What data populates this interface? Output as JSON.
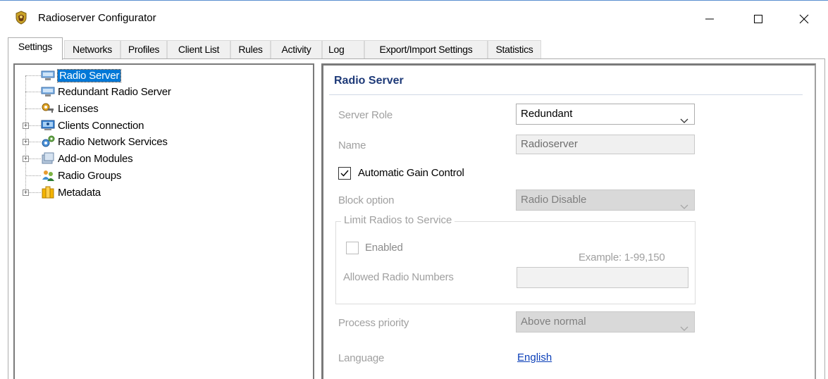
{
  "window": {
    "title": "Radioserver Configurator",
    "controls": {
      "minimize": "minimize-icon",
      "maximize": "maximize-icon",
      "close": "close-icon"
    }
  },
  "tabs": [
    "Settings",
    "Networks",
    "Profiles",
    "Client List",
    "Rules",
    "Activity",
    "Log",
    "Export/Import Settings",
    "Statistics"
  ],
  "active_tab": "Settings",
  "tree": {
    "items": [
      {
        "label": "Radio Server",
        "icon": "server-icon",
        "selected": true
      },
      {
        "label": "Redundant Radio Server",
        "icon": "server-icon"
      },
      {
        "label": "Licenses",
        "icon": "key-icon"
      },
      {
        "label": "Clients Connection",
        "icon": "network-icon",
        "expandable": true
      },
      {
        "label": "Radio Network Services",
        "icon": "gear-network-icon",
        "expandable": true
      },
      {
        "label": "Add-on Modules",
        "icon": "modules-icon",
        "expandable": true
      },
      {
        "label": "Radio Groups",
        "icon": "users-icon"
      },
      {
        "label": "Metadata",
        "icon": "metadata-icon",
        "expandable": true
      }
    ]
  },
  "settings": {
    "section_title": "Radio Server",
    "server_role": {
      "label": "Server Role",
      "value": "Redundant"
    },
    "name": {
      "label": "Name",
      "value": "Radioserver"
    },
    "agc": {
      "label": "Automatic Gain Control",
      "checked": true
    },
    "block_option": {
      "label": "Block option",
      "value": "Radio Disable"
    },
    "limit_group": {
      "legend": "Limit Radios to Service",
      "enabled_label": "Enabled",
      "enabled": false,
      "example": "Example: 1-99,150",
      "allowed_label": "Allowed Radio Numbers",
      "allowed_value": ""
    },
    "process_priority": {
      "label": "Process priority",
      "value": "Above normal"
    },
    "language": {
      "label": "Language",
      "value": "English"
    }
  },
  "colors": {
    "selection": "#0078d7",
    "section_title": "#1e3a78",
    "link": "#0b3fb8",
    "disabled_text": "#a0a0a0"
  }
}
